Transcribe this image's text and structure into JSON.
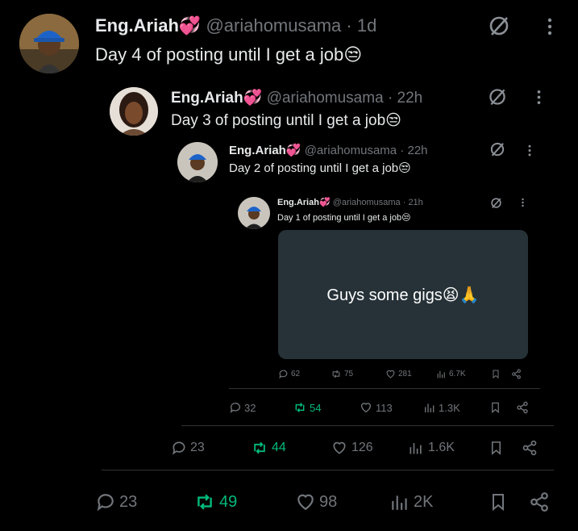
{
  "colors": {
    "background": "#000000",
    "text": "#e7e9ea",
    "muted": "#71767b",
    "retweet": "#00ba7c",
    "heart_emoji": "#ff4fa3",
    "card": "#263238"
  },
  "posts": [
    {
      "author": "Eng.Ariah",
      "name_emoji": "💞",
      "handle": "@ariahomusama",
      "time": "· 1d",
      "text": "Day 4 of posting until I get a job",
      "text_emoji": "😒",
      "icons": [
        "grok-icon",
        "more-vertical-icon"
      ],
      "replies": "23",
      "reposts": "49",
      "likes": "98",
      "views": "2K"
    },
    {
      "author": "Eng.Ariah",
      "name_emoji": "💞",
      "handle": "@ariahomusama",
      "time": "· 22h",
      "text": "Day 3 of posting until I get a job",
      "text_emoji": "😒",
      "replies": "23",
      "reposts": "44",
      "likes": "126",
      "views": "1.6K"
    },
    {
      "author": "Eng.Ariah",
      "name_emoji": "💞",
      "handle": "@ariahomusama",
      "time": "· 22h",
      "text": "Day 2 of posting until I get a job",
      "text_emoji": "😒",
      "replies": "32",
      "reposts": "54",
      "likes": "113",
      "views": "1.3K"
    },
    {
      "author": "Eng.Ariah",
      "name_emoji": "💞",
      "handle": "@ariahomusama",
      "time": "· 21h",
      "text": "Day 1 of posting until I get a job",
      "text_emoji": "😒",
      "media_text": "Guys some gigs😫🙏",
      "replies": "62",
      "reposts": "75",
      "likes": "281",
      "views": "6.7K"
    }
  ]
}
